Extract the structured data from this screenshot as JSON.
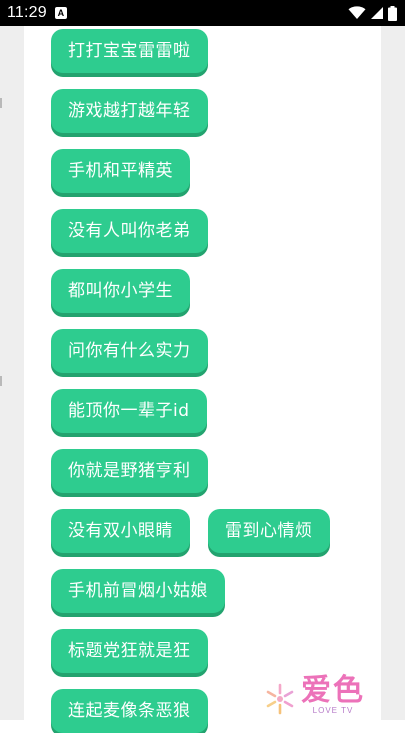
{
  "status_bar": {
    "time": "11:29",
    "notification_icon": "A"
  },
  "buttons": [
    {
      "label": "打打宝宝雷雷啦"
    },
    {
      "label": "游戏越打越年轻"
    },
    {
      "label": "手机和平精英"
    },
    {
      "label": "没有人叫你老弟"
    },
    {
      "label": "都叫你小学生"
    },
    {
      "label": "问你有什么实力"
    },
    {
      "label": "能顶你一辈子id"
    },
    {
      "label": "你就是野猪亨利"
    },
    {
      "label": "没有双小眼睛"
    },
    {
      "label": "雷到心情烦"
    },
    {
      "label": "手机前冒烟小姑娘"
    },
    {
      "label": "标题党狂就是狂"
    },
    {
      "label": "连起麦像条恶狼"
    }
  ],
  "watermark": {
    "brand": "爱色",
    "sub": "LOVE TV"
  },
  "colors": {
    "button": "#2ecc8f",
    "button_shadow": "#23a36f",
    "watermark_pink": "#ec72b9"
  }
}
